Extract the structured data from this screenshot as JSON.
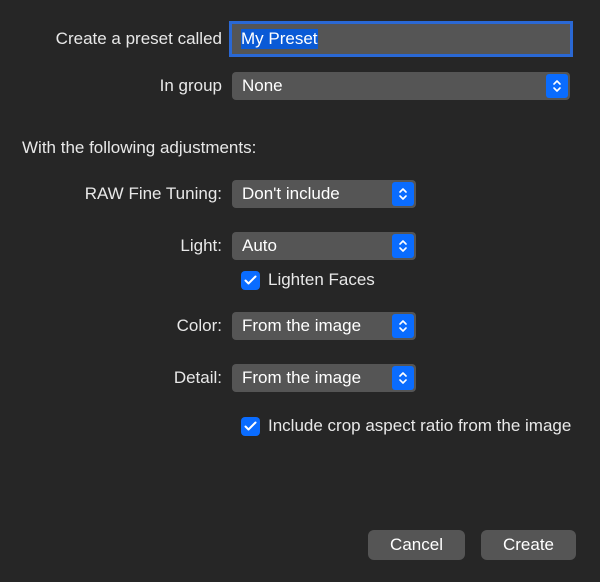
{
  "preset": {
    "name_label": "Create a preset called",
    "name_value": "My Preset",
    "group_label": "In group",
    "group_value": "None"
  },
  "adjustments_heading": "With the following adjustments:",
  "adjustments": {
    "raw_fine_tuning": {
      "label": "RAW Fine Tuning:",
      "value": "Don't include"
    },
    "light": {
      "label": "Light:",
      "value": "Auto"
    },
    "lighten_faces_label": "Lighten Faces",
    "color": {
      "label": "Color:",
      "value": "From the image"
    },
    "detail": {
      "label": "Detail:",
      "value": "From the image"
    },
    "include_crop_label": "Include crop aspect ratio from the image"
  },
  "buttons": {
    "cancel": "Cancel",
    "create": "Create"
  }
}
